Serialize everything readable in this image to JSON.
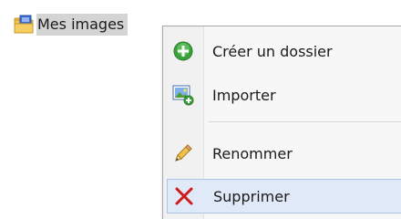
{
  "tree": {
    "node_label": "Mes images",
    "node_icon": "folder-images-icon"
  },
  "context_menu": {
    "items": [
      {
        "label": "Créer un dossier",
        "icon": "add-folder-icon",
        "highlighted": false
      },
      {
        "label": "Importer",
        "icon": "import-image-icon",
        "highlighted": false
      },
      {
        "label": "Renommer",
        "icon": "pencil-icon",
        "highlighted": false
      },
      {
        "label": "Supprimer",
        "icon": "delete-x-icon",
        "highlighted": true
      }
    ]
  },
  "colors": {
    "hover_background": "#dfe9f7",
    "hover_border": "#a9c4e8",
    "add_icon_green": "#3aa13a",
    "delete_icon_red": "#d11b1b"
  }
}
